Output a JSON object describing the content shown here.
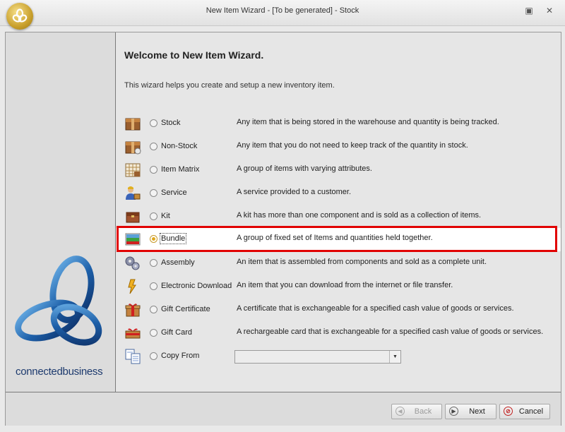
{
  "window": {
    "title": "New Item Wizard - [To be generated] - Stock"
  },
  "brand": {
    "part1": "connected",
    "part2": "business"
  },
  "main": {
    "heading": "Welcome to New Item Wizard.",
    "description": "This wizard helps you create and setup a new inventory item."
  },
  "item_types": [
    {
      "label": "Stock",
      "description": "Any item that is being stored in the warehouse and quantity is being tracked.",
      "icon": "box-icon",
      "selected": false
    },
    {
      "label": "Non-Stock",
      "description": "Any item that you do not need to keep track of the quantity in stock.",
      "icon": "box-icon",
      "selected": false
    },
    {
      "label": "Item Matrix",
      "description": "A group of items with varying attributes.",
      "icon": "matrix-icon",
      "selected": false
    },
    {
      "label": "Service",
      "description": "A service provided to a customer.",
      "icon": "service-person-icon",
      "selected": false
    },
    {
      "label": "Kit",
      "description": "A kit has more than one component and is sold as a collection of items.",
      "icon": "kit-chest-icon",
      "selected": false
    },
    {
      "label": "Bundle",
      "description": "A group of fixed set of Items and quantities held together.",
      "icon": "bundle-icon",
      "selected": true
    },
    {
      "label": "Assembly",
      "description": "An item that is assembled from components and sold as a complete unit.",
      "icon": "gears-icon",
      "selected": false
    },
    {
      "label": "Electronic Download",
      "description": "An item that you can download from the internet or file transfer.",
      "icon": "download-arrow-icon",
      "selected": false
    },
    {
      "label": "Gift Certificate",
      "description": "A certificate that is exchangeable for a specified cash value of goods or services.",
      "icon": "gift-box-icon",
      "selected": false
    },
    {
      "label": "Gift Card",
      "description": "A rechargeable card that is exchangeable for a specified cash value of goods or services.",
      "icon": "gift-card-icon",
      "selected": false
    },
    {
      "label": "Copy From",
      "description": "",
      "icon": "copy-documents-icon",
      "selected": false
    }
  ],
  "copy_from": {
    "value": ""
  },
  "buttons": {
    "back": "Back",
    "next": "Next",
    "cancel": "Cancel"
  },
  "colors": {
    "highlight": "#e10000",
    "brand_blue": "#1d5fa8",
    "logo_gold": "#c9a02c"
  }
}
